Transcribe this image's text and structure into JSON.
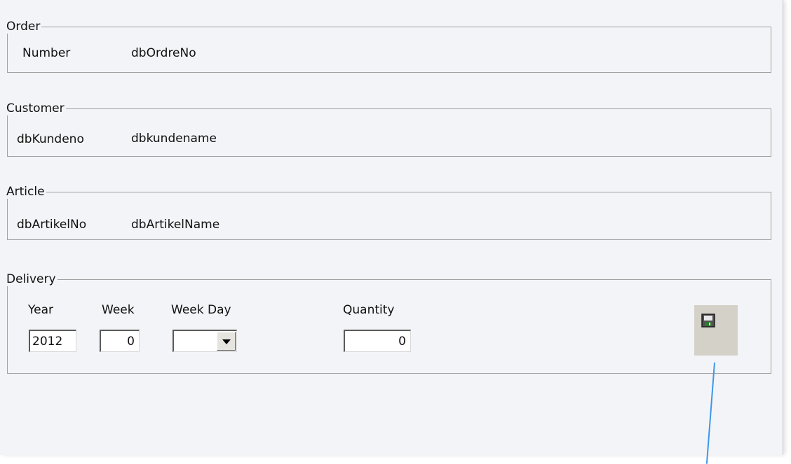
{
  "order": {
    "title": "Order",
    "number_label": "Number",
    "number_value": "dbOrdreNo"
  },
  "customer": {
    "title": "Customer",
    "id_value": "dbKundeno",
    "name_value": "dbkundename"
  },
  "article": {
    "title": "Article",
    "id_value": "dbArtikelNo",
    "name_value": "dbArtikelName"
  },
  "delivery": {
    "title": "Delivery",
    "year_label": "Year",
    "year_value": "2012",
    "week_label": "Week",
    "week_value": "0",
    "weekday_label": "Week Day",
    "weekday_value": "",
    "quantity_label": "Quantity",
    "quantity_value": "0"
  },
  "icons": {
    "save": "floppy-disk-icon",
    "dropdown": "chevron-down-icon"
  },
  "colors": {
    "background": "#f3f4f8",
    "connector_line": "#3d97e8",
    "save_button_bg": "#d4d1c9"
  }
}
